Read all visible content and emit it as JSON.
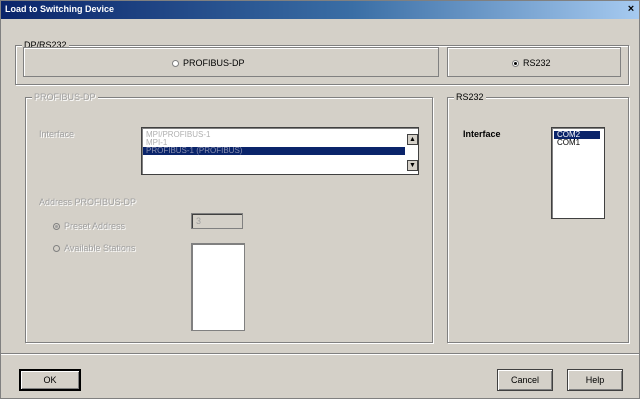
{
  "window": {
    "title": "Load to Switching Device",
    "close_glyph": "×"
  },
  "connection": {
    "legend": "DP/RS232",
    "profibus_label": "PROFIBUS-DP",
    "profibus_selected": false,
    "rs232_label": "RS232",
    "rs232_selected": true
  },
  "profibus_panel": {
    "legend": "PROFIBUS-DP",
    "interface_label": "Interface",
    "interface_items": [
      {
        "label": "MPI/PROFIBUS-1",
        "selected": false
      },
      {
        "label": "MPI-1",
        "selected": false
      },
      {
        "label": "PROFIBUS-1 (PROFIBUS)",
        "selected": true
      }
    ],
    "address_legend": "Address PROFIBUS-DP",
    "preset_label": "Preset Address",
    "preset_selected": true,
    "preset_value": "3",
    "available_label": "Available Stations",
    "available_selected": false
  },
  "rs232_panel": {
    "legend": "RS232",
    "interface_label": "Interface",
    "ports": [
      {
        "label": "COM2",
        "selected": true
      },
      {
        "label": "COM1",
        "selected": false
      }
    ]
  },
  "buttons": {
    "ok": "OK",
    "cancel": "Cancel",
    "help": "Help"
  }
}
